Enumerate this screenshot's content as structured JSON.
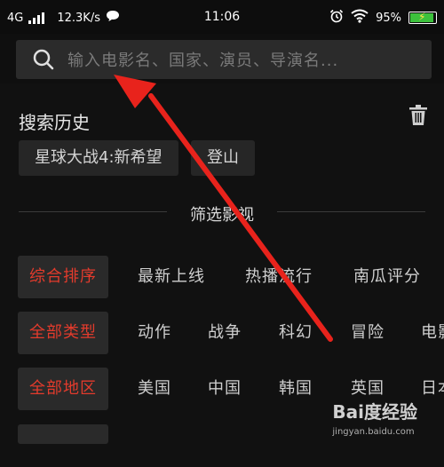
{
  "status_bar": {
    "network": "4G",
    "speed": "12.3K/s",
    "time": "11:06",
    "battery": "95%"
  },
  "search": {
    "placeholder": "输入电影名、国家、演员、导演名..."
  },
  "history": {
    "title": "搜索历史",
    "items": [
      "星球大战4:新希望",
      "登山"
    ]
  },
  "filter": {
    "heading": "筛选影视",
    "rows": [
      {
        "selected": "综合排序",
        "options": [
          "最新上线",
          "热播流行",
          "南瓜评分"
        ]
      },
      {
        "selected": "全部类型",
        "options": [
          "动作",
          "战争",
          "科幻",
          "冒险",
          "电影"
        ]
      },
      {
        "selected": "全部地区",
        "options": [
          "美国",
          "中国",
          "韩国",
          "英国",
          "日本"
        ]
      }
    ]
  },
  "colors": {
    "accent": "#e33b2c",
    "background": "#111111",
    "chip": "#2a2a2a",
    "annotation_arrow": "#e8231c"
  },
  "watermark": {
    "brand": "Bai度经验",
    "url": "jingyan.baidu.com"
  }
}
